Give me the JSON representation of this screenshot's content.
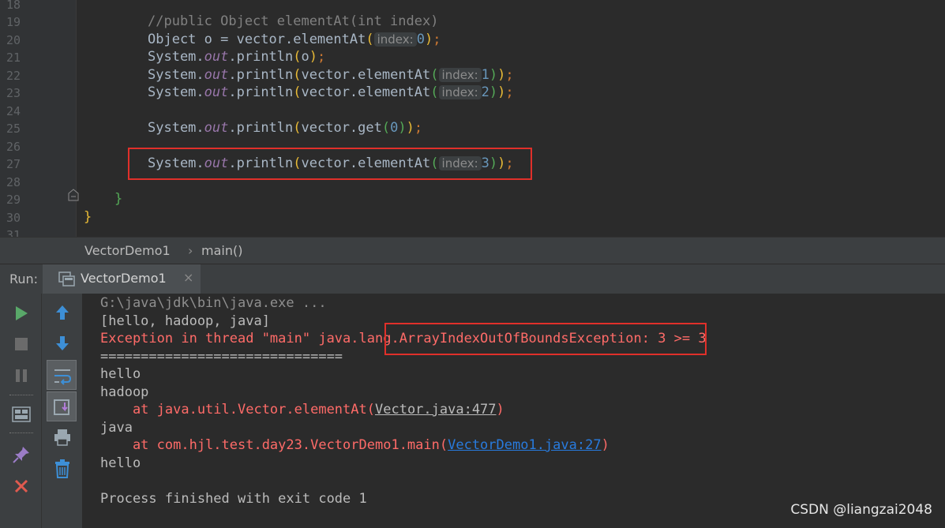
{
  "editor": {
    "line_numbers": [
      "18",
      "19",
      "20",
      "21",
      "22",
      "23",
      "24",
      "25",
      "26",
      "27",
      "28",
      "29",
      "30",
      "31"
    ],
    "hint_label": "index:",
    "lines": {
      "l19": "//public Object elementAt(int index)",
      "l20_a": "Object o = vector.elementAt",
      "l20_arg": "0",
      "l21_a": "System.",
      "out": "out",
      "println": ".println",
      "l21_arg": "o",
      "l22_arg": "vector.elementAt",
      "l22_num": "1",
      "l23_num": "2",
      "l25_arg": "vector.get",
      "l25_num": "0",
      "l27_num": "3",
      "brace": "}"
    }
  },
  "breadcrumb": {
    "class": "VectorDemo1",
    "sep": "›",
    "method": "main()"
  },
  "run": {
    "label": "Run:",
    "tab": "VectorDemo1",
    "close": "×"
  },
  "console": {
    "l1": "G:\\java\\jdk\\bin\\java.exe ...",
    "l2": "[hello, hadoop, java]",
    "l3": "Exception in thread \"main\" java.lang.ArrayIndexOutOfBoundsException: 3 >= 3",
    "l4": "==============================",
    "l5": "hello",
    "l6": "hadoop",
    "l7_a": "    at java.util.Vector.elementAt(",
    "l7_link": "Vector.java:477",
    "l7_b": ")",
    "l8": "java",
    "l9_a": "    at com.hjl.test.day23.VectorDemo1.main(",
    "l9_link": "VectorDemo1.java:27",
    "l9_b": ")",
    "l10": "hello",
    "l12": "Process finished with exit code 1"
  },
  "tools": {
    "left": [
      "rerun-icon",
      "stop-icon",
      "pause-icon",
      "layout-icon",
      "pin-icon",
      "close-icon"
    ],
    "right": [
      "up-arrow-icon",
      "down-arrow-icon",
      "soft-wrap-icon",
      "scroll-end-icon",
      "print-icon",
      "trash-icon"
    ]
  },
  "watermark": "CSDN @liangzai2048",
  "colors": {
    "error": "#ff6b68",
    "highlight_box": "#e0302a",
    "run_green": "#59a869"
  }
}
